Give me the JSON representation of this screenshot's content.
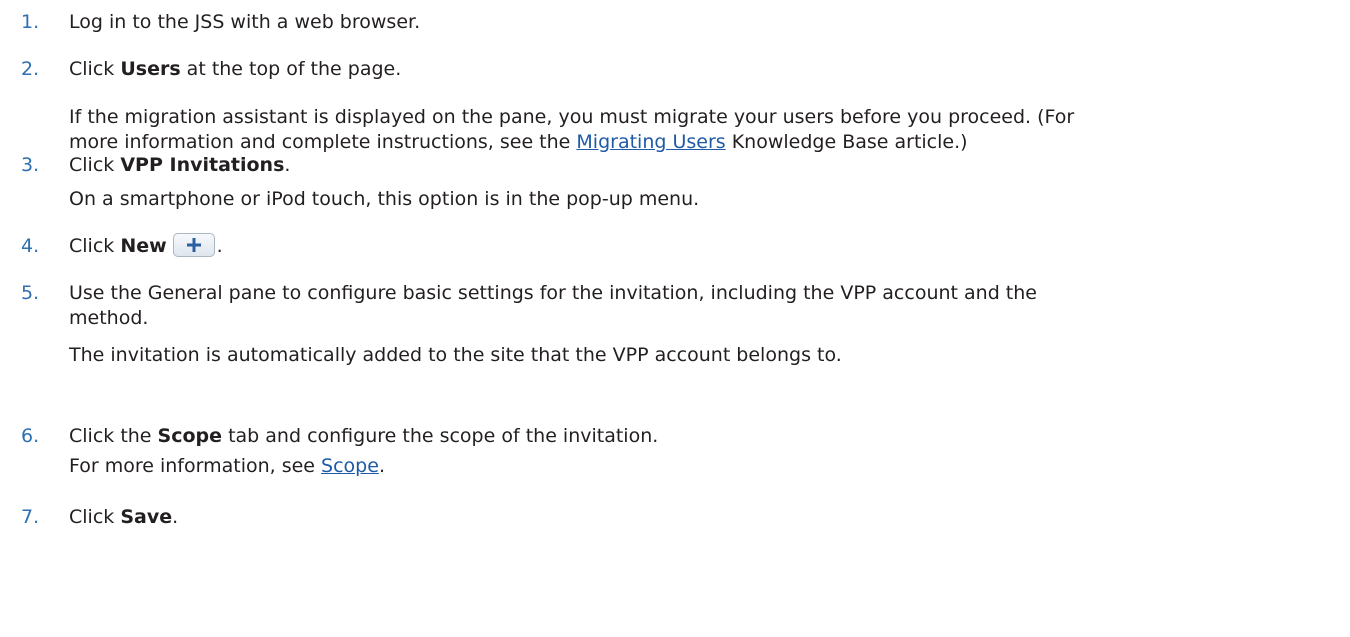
{
  "steps": [
    {
      "number": "1.",
      "text": "Log in to the JSS with a web browser."
    },
    {
      "number": "2.",
      "pre": "Click ",
      "bold": "Users",
      "post": " at the top of the page.",
      "note_line1": "If the migration assistant is displayed on the pane, you must migrate your users before you proceed. (For",
      "note_line2_pre": "more information and complete instructions, see the ",
      "note_link": "Migrating Users",
      "note_line2_post": " Knowledge Base article.)"
    },
    {
      "number": "3.",
      "pre": "Click ",
      "bold": "VPP Invitations",
      "post": ".",
      "note": "On a smartphone or iPod touch, this option is in the pop-up menu."
    },
    {
      "number": "4.",
      "pre": "Click ",
      "bold": "New",
      "post": ".",
      "button_icon": "plus-icon"
    },
    {
      "number": "5.",
      "line1": "Use the General pane to configure basic settings for the invitation, including the VPP account and the",
      "line2": "method.",
      "note": "The invitation is automatically added to the site that the VPP account belongs to."
    },
    {
      "number": "6.",
      "pre": "Click the ",
      "bold": "Scope",
      "post": " tab and configure the scope of the invitation.",
      "note_pre": "For more information, see ",
      "note_link": "Scope",
      "note_post": "."
    },
    {
      "number": "7.",
      "pre": "Click ",
      "bold": "Save",
      "post": "."
    }
  ],
  "colors": {
    "number": "#2e6fb0",
    "link": "#1f5aa6",
    "text": "#231f20"
  }
}
